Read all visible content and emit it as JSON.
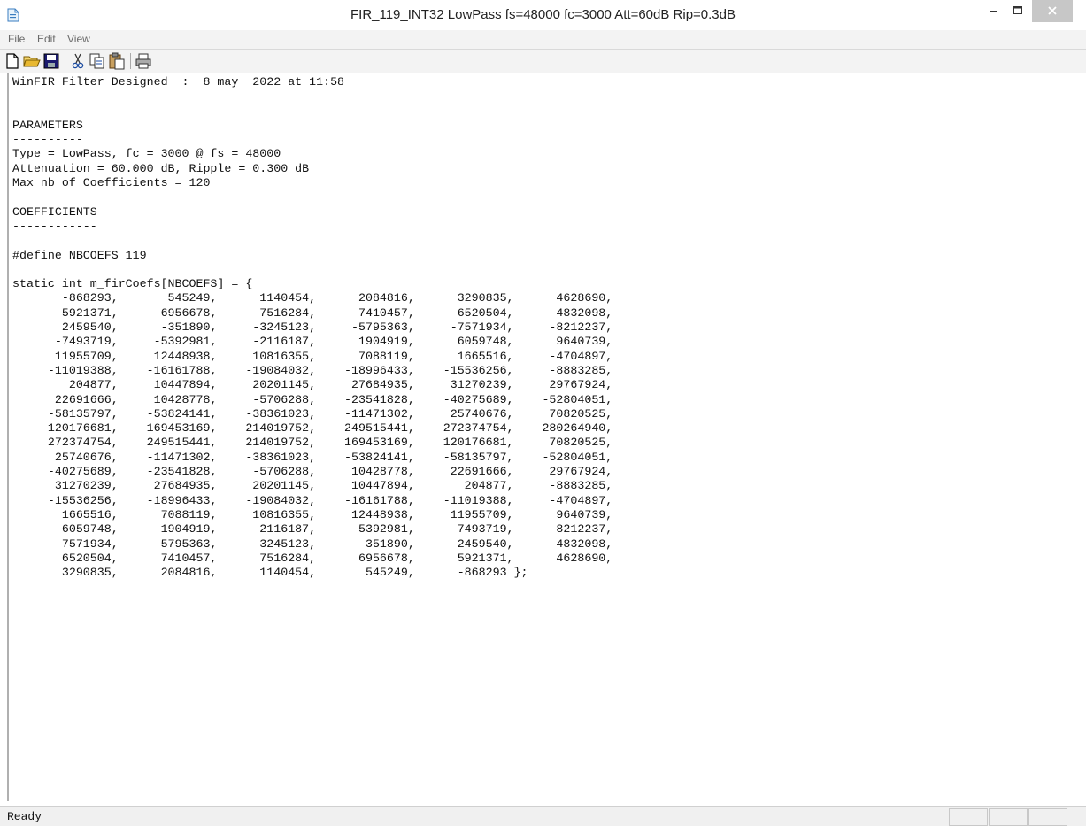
{
  "window": {
    "title": "FIR_119_INT32 LowPass fs=48000 fc=3000 Att=60dB Rip=0.3dB"
  },
  "menu": [
    "File",
    "Edit",
    "View"
  ],
  "toolbar": {
    "buttons": [
      {
        "icon": "new-document-icon"
      },
      {
        "icon": "open-folder-icon"
      },
      {
        "icon": "save-disk-icon"
      },
      {
        "icon": "cut-scissors-icon"
      },
      {
        "icon": "copy-icon"
      },
      {
        "icon": "paste-icon"
      },
      {
        "icon": "print-icon"
      }
    ]
  },
  "document": {
    "header": "WinFIR Filter Designed  :  8 may  2022 at 11:58",
    "header_rule": "-----------------------------------------------",
    "parameters_title": "PARAMETERS",
    "parameters_rule": "----------",
    "param_type": "Type = LowPass, fc = 3000 @ fs = 48000",
    "param_attenuation": "Attenuation = 60.000 dB, Ripple = 0.300 dB",
    "param_max_coefs": "Max nb of Coefficients = 120",
    "coefficients_title": "COEFFICIENTS",
    "coefficients_rule": "------------",
    "define_line": "#define NBCOEFS 119",
    "array_decl": "static int m_firCoefs[NBCOEFS] = {",
    "coefficient_rows": [
      "       -868293,       545249,      1140454,      2084816,      3290835,      4628690,",
      "       5921371,      6956678,      7516284,      7410457,      6520504,      4832098,",
      "       2459540,      -351890,     -3245123,     -5795363,     -7571934,     -8212237,",
      "      -7493719,     -5392981,     -2116187,      1904919,      6059748,      9640739,",
      "      11955709,     12448938,     10816355,      7088119,      1665516,     -4704897,",
      "     -11019388,    -16161788,    -19084032,    -18996433,    -15536256,     -8883285,",
      "        204877,     10447894,     20201145,     27684935,     31270239,     29767924,",
      "      22691666,     10428778,     -5706288,    -23541828,    -40275689,    -52804051,",
      "     -58135797,    -53824141,    -38361023,    -11471302,     25740676,     70820525,",
      "     120176681,    169453169,    214019752,    249515441,    272374754,    280264940,",
      "     272374754,    249515441,    214019752,    169453169,    120176681,     70820525,",
      "      25740676,    -11471302,    -38361023,    -53824141,    -58135797,    -52804051,",
      "     -40275689,    -23541828,     -5706288,     10428778,     22691666,     29767924,",
      "      31270239,     27684935,     20201145,     10447894,       204877,     -8883285,",
      "     -15536256,    -18996433,    -19084032,    -16161788,    -11019388,     -4704897,",
      "       1665516,      7088119,     10816355,     12448938,     11955709,      9640739,",
      "       6059748,      1904919,     -2116187,     -5392981,     -7493719,     -8212237,",
      "      -7571934,     -5795363,     -3245123,      -351890,      2459540,      4832098,",
      "       6520504,      7410457,      7516284,      6956678,      5921371,      4628690,",
      "       3290835,      2084816,      1140454,       545249,      -868293 };"
    ]
  },
  "status": {
    "text": "Ready"
  }
}
